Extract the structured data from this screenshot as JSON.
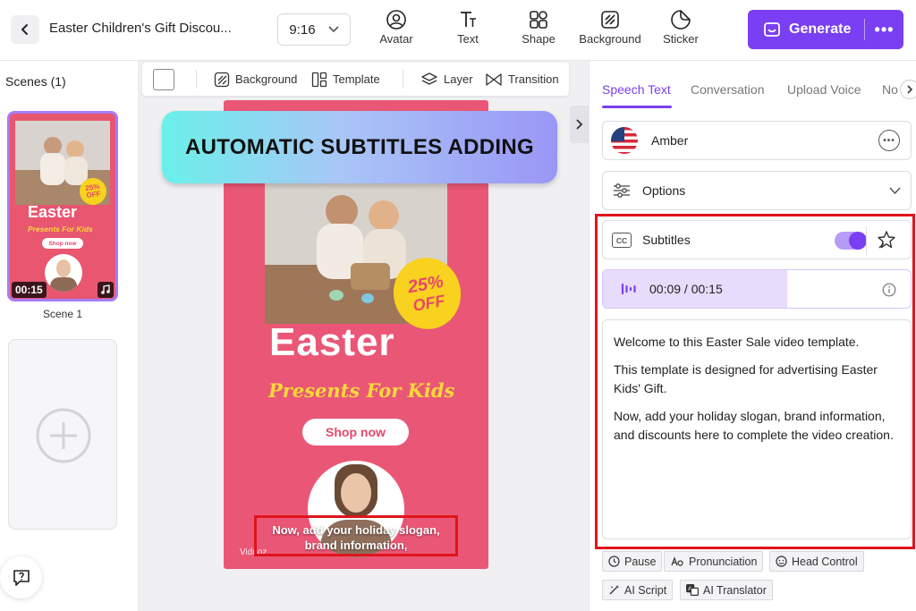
{
  "topbar": {
    "title": "Easter Children's Gift Discou...",
    "ratio": "9:16",
    "tools": [
      {
        "label": "Avatar",
        "icon": "avatar-icon"
      },
      {
        "label": "Text",
        "icon": "text-icon"
      },
      {
        "label": "Shape",
        "icon": "shape-icon"
      },
      {
        "label": "Background",
        "icon": "background-icon"
      },
      {
        "label": "Sticker",
        "icon": "sticker-icon"
      }
    ],
    "generate_label": "Generate",
    "more_label": "•••"
  },
  "sidebar": {
    "scenes_title": "Scenes (1)",
    "scene": {
      "label": "Scene 1",
      "duration": "00:15",
      "thumb_title": "Easter",
      "thumb_subtitle": "Presents For Kids",
      "thumb_button": "Shop now",
      "thumb_badge_top": "25%",
      "thumb_badge_bottom": "OFF"
    }
  },
  "canvas_toolbar": {
    "background_label": "Background",
    "template_label": "Template",
    "layer_label": "Layer",
    "transition_label": "Transition"
  },
  "banner": "AUTOMATIC SUBTITLES ADDING",
  "preview": {
    "title": "Easter",
    "subtitle": "Presents For Kids",
    "button": "Shop now",
    "badge_top": "25%",
    "badge_bottom": "OFF",
    "subtitle_text": "Now, add your holiday slogan, brand information,",
    "watermark": "Vidnoz"
  },
  "right_panel": {
    "tabs": [
      "Speech Text",
      "Conversation",
      "Upload Voice",
      "No"
    ],
    "voice_name": "Amber",
    "options_label": "Options",
    "subtitles_label": "Subtitles",
    "subtitles_on": true,
    "playback_time": "00:09 / 00:15",
    "progress": 0.6,
    "script": [
      "Welcome to this Easter Sale video template.",
      "This template is designed for advertising Easter Kids' Gift.",
      "Now, add your holiday slogan, brand information, and discounts here to complete the video creation."
    ],
    "actions": [
      "Pause",
      "Pronunciation",
      "Head Control",
      "AI Script",
      "AI Translator"
    ]
  },
  "colors": {
    "accent": "#7a3ff2",
    "canvas_pink": "#ea5776",
    "highlight_red": "#e0141b"
  }
}
